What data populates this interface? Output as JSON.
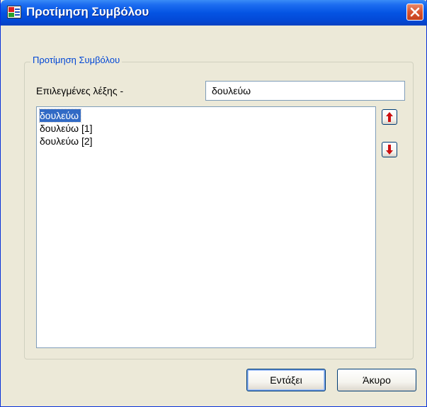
{
  "window": {
    "title": "Προτίμηση Συμβόλου",
    "colors": {
      "titlebar": "#0454e3",
      "close": "#d9532e",
      "group_label": "#0046d5",
      "selection": "#316ac5"
    },
    "icons": {
      "app": "app-window-icon",
      "close": "close-icon"
    }
  },
  "group": {
    "label": "Προτίμηση Συμβόλου"
  },
  "selected_word": {
    "label": "Επιλεγμένες λέξης -",
    "value": "δουλεύω"
  },
  "list": {
    "items": [
      {
        "label": "δουλεύω",
        "selected": true
      },
      {
        "label": "δουλεύω [1]",
        "selected": false
      },
      {
        "label": "δουλεύω [2]",
        "selected": false
      }
    ]
  },
  "side_buttons": {
    "up_icon": "arrow-up-icon",
    "down_icon": "arrow-down-icon"
  },
  "buttons": {
    "ok_label": "Εντάξει",
    "cancel_label": "Άκυρο"
  }
}
